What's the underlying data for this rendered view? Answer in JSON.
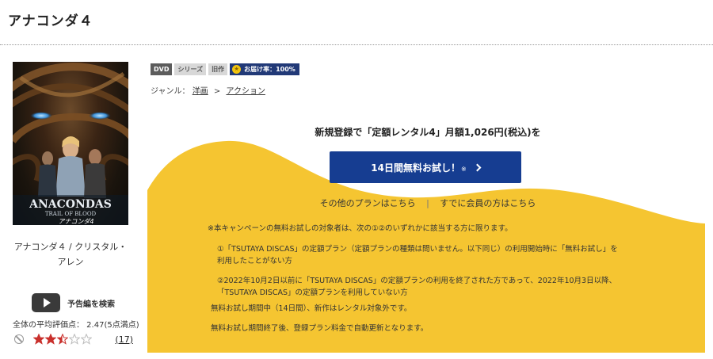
{
  "page": {
    "title": "アナコンダ４"
  },
  "cover": {
    "title_art": "ANACONDAS",
    "subtitle_art": "TRAIL OF BLOOD",
    "caption": "アナコンダ４ / クリスタル・アレン"
  },
  "trailer": {
    "label": "予告編を検索",
    "icon": "play-icon"
  },
  "rating": {
    "average_text": "全体の平均評価点： 2.47(5点満点)",
    "value": 2.47,
    "max": 5,
    "review_count": "(17)",
    "icon": "ban-icon"
  },
  "badges": {
    "dvd": "DVD",
    "series": "シリーズ",
    "old": "旧作",
    "delivery": "お届け率：100%"
  },
  "genre": {
    "label": "ジャンル：",
    "items": [
      "洋画",
      "アクション"
    ],
    "separator": ">"
  },
  "campaign": {
    "headline": "新規登録で「定額レンタル4」月額1,026円(税込)を",
    "button_label": "14日間無料お試し！",
    "button_note": "※",
    "other_plans": "その他のプランはこちら",
    "divider": "|",
    "member_link": "すでに会員の方はこちら",
    "notes": [
      "※本キャンペーンの無料お試しの対象者は、次の①②のいずれかに該当する方に限ります。",
      "①「TSUTAYA DISCAS」の定額プラン（定額プランの種類は問いません。以下同じ）の利用開始時に「無料お試し」を",
      "利用したことがない方",
      "②2022年10月2日以前に「TSUTAYA DISCAS」の定額プランの利用を終了された方であって、2022年10月3日以降、",
      "「TSUTAYA DISCAS」の定額プランを利用していない方",
      "無料お試し期間中（14日間）、新作はレンタル対象外です。",
      "無料お試し期間終了後、登録プラン料金で自動更新となります。"
    ]
  },
  "colors": {
    "yellow": "#f5c531",
    "button_blue": "#163d91",
    "badge_navy": "#213977",
    "star_filled": "#c9302c"
  }
}
